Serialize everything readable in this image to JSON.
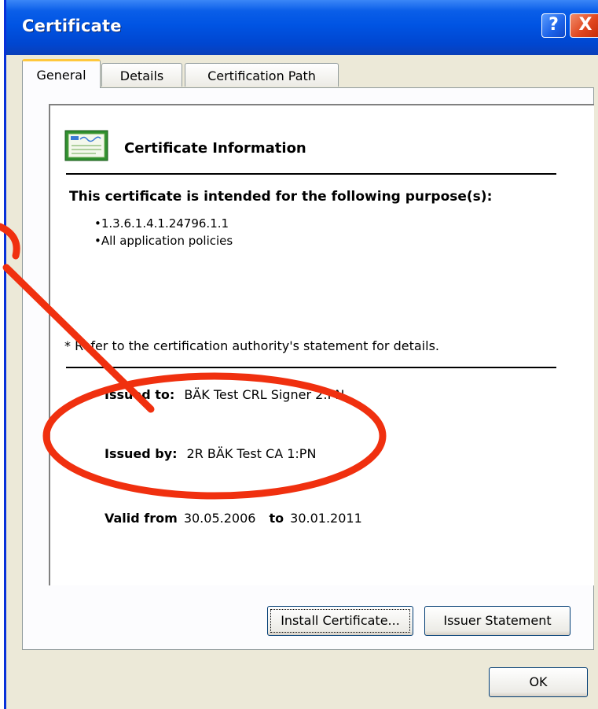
{
  "window": {
    "title": "Certificate",
    "help_label": "?",
    "close_label": "X"
  },
  "tabs": [
    {
      "label": "General",
      "active": true
    },
    {
      "label": "Details",
      "active": false
    },
    {
      "label": "Certification Path",
      "active": false
    }
  ],
  "info": {
    "heading": "Certificate Information",
    "purpose_heading": "This certificate is intended for the following purpose(s):",
    "purposes": [
      "•1.3.6.1.4.1.24796.1.1",
      "•All application policies"
    ],
    "refer_note": "* Refer to the certification authority's statement for details.",
    "issued_to_label": "Issued to:",
    "issued_to_value": "BÄK Test CRL Signer 2:PN",
    "issued_by_label": "Issued by:",
    "issued_by_value": "2R BÄK Test CA 1:PN",
    "valid_from_label": "Valid from",
    "valid_from_value": "30.05.2006",
    "valid_to_label": "to",
    "valid_to_value": "30.01.2011"
  },
  "buttons": {
    "install": "Install Certificate...",
    "issuer": "Issuer Statement",
    "ok": "OK"
  },
  "annotation": {
    "color": "#f0300f"
  },
  "colors": {
    "titlebar": "#0054e3",
    "dialog_bg": "#ece9d8",
    "tab_highlight": "#ffc83c"
  }
}
